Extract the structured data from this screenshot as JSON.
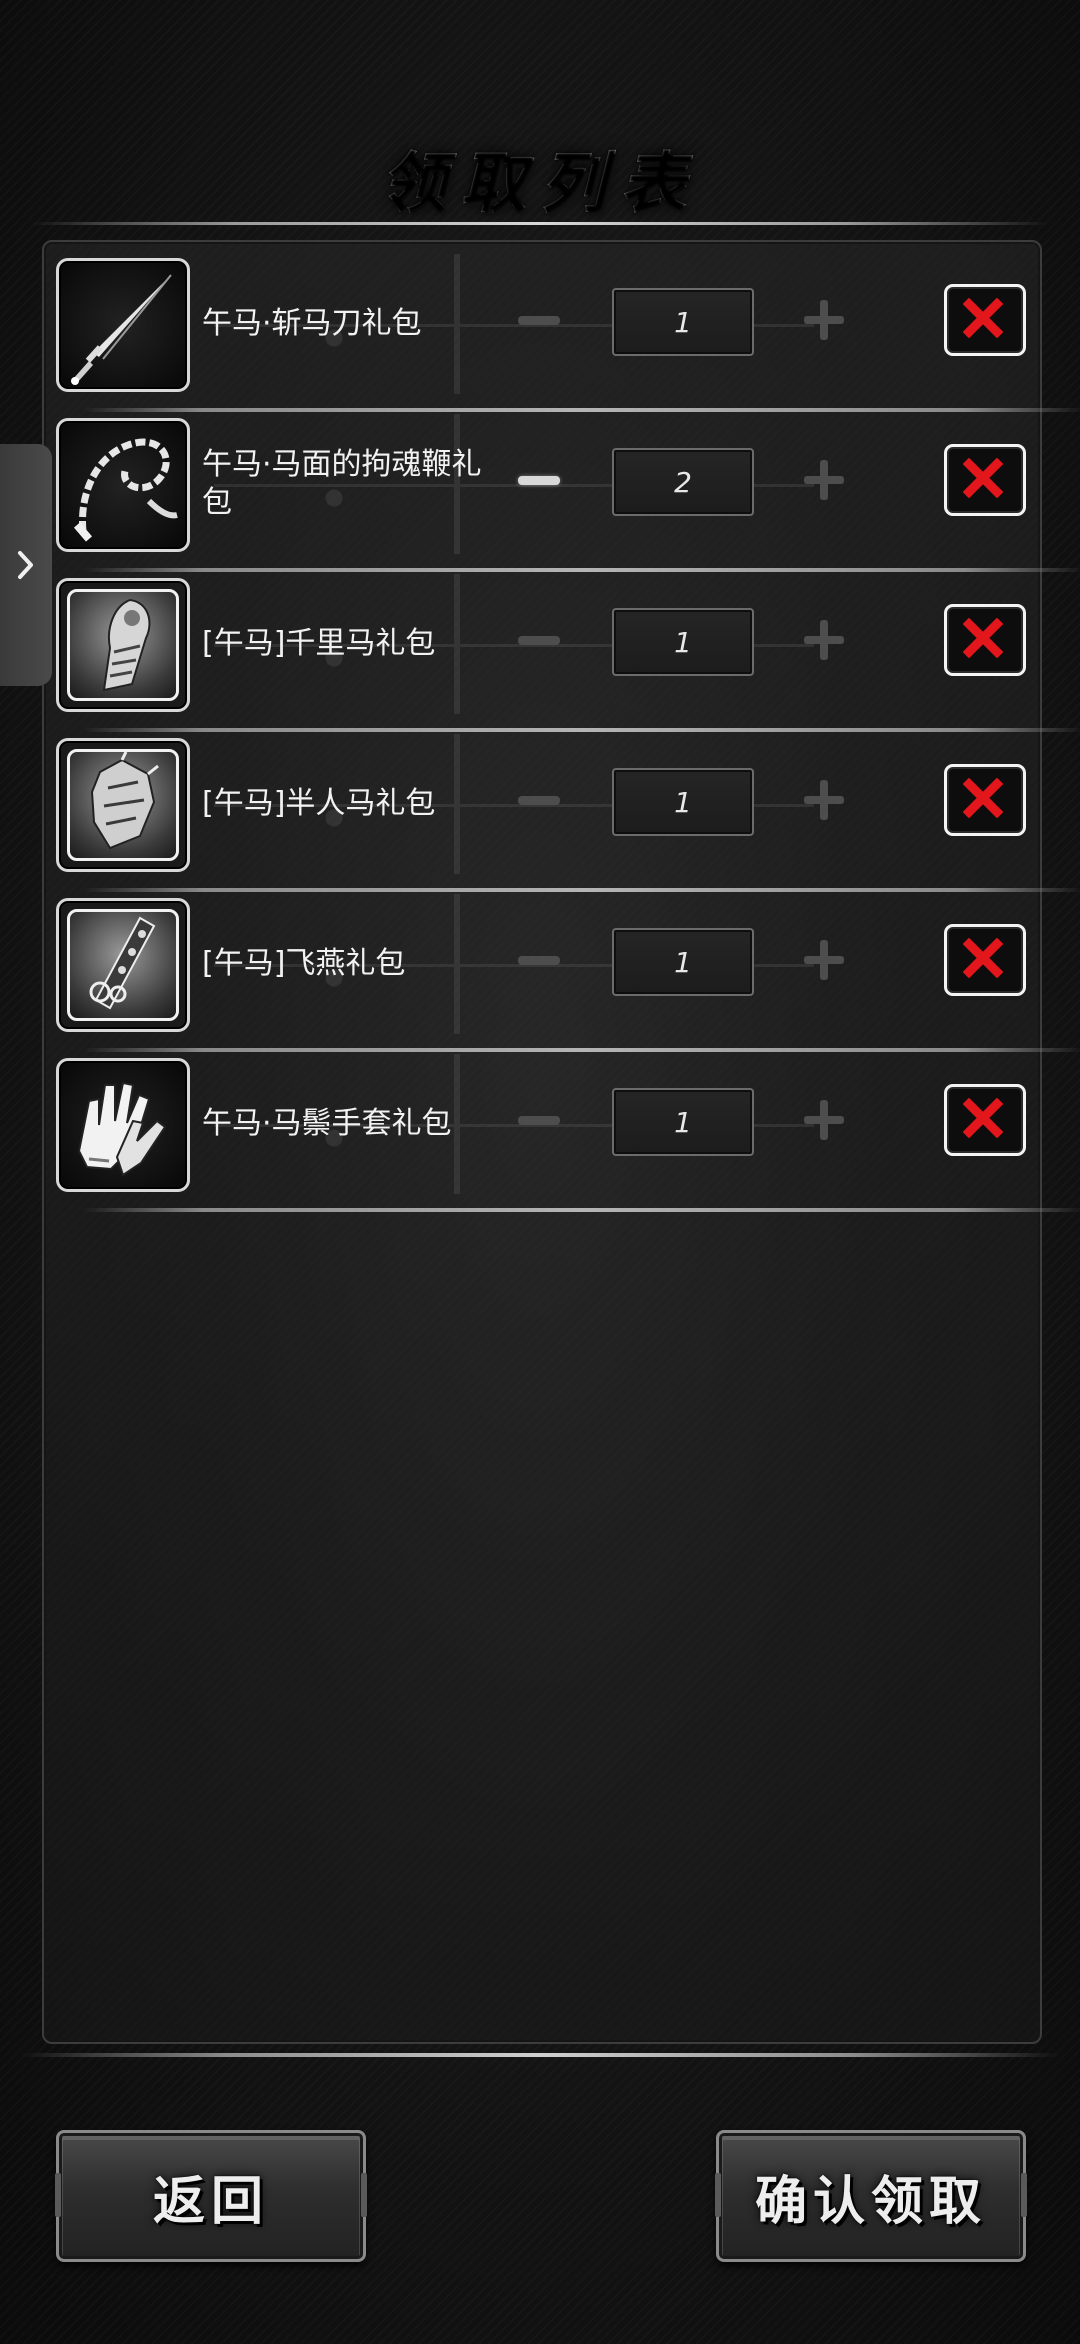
{
  "title": "领取列表",
  "items": [
    {
      "name": "午马·斩马刀礼包",
      "quantity": "1",
      "icon": "sword-icon"
    },
    {
      "name": "午马·马面的拘魂鞭礼包",
      "quantity": "2",
      "icon": "whip-icon"
    },
    {
      "name": "[午马]千里马礼包",
      "quantity": "1",
      "icon": "arm-armor-icon"
    },
    {
      "name": "[午马]半人马礼包",
      "quantity": "1",
      "icon": "centaur-armor-icon"
    },
    {
      "name": "[午马]飞燕礼包",
      "quantity": "1",
      "icon": "chain-blade-icon"
    },
    {
      "name": "午马·马鬃手套礼包",
      "quantity": "1",
      "icon": "gloves-icon"
    }
  ],
  "buttons": {
    "back": "返回",
    "confirm": "确认领取"
  },
  "colors": {
    "delete_x": "#e3161b",
    "background": "#1b1b1b"
  }
}
